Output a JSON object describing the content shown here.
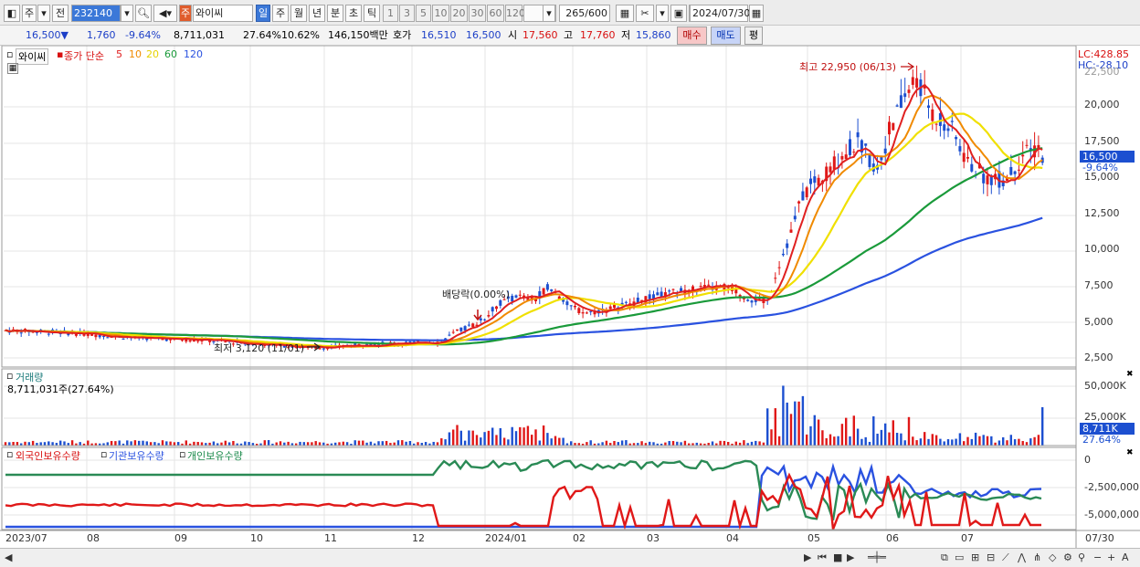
{
  "toolbar": {
    "market_type": "주",
    "prev_label": "전",
    "code": "232140",
    "stock_name": "와이씨",
    "name_prefix": "주",
    "periods": [
      "일",
      "주",
      "월",
      "년",
      "분",
      "초",
      "틱"
    ],
    "period_selected": "일",
    "intervals": [
      "1",
      "3",
      "5",
      "10",
      "20",
      "30",
      "60",
      "120"
    ],
    "count": "265",
    "count_max": "/600",
    "date": "2024/07/30"
  },
  "quote": {
    "price": "16,500",
    "down_mark": "▼",
    "change": "1,760",
    "change_pct": "-9.64%",
    "volume": "8,711,031",
    "turnover_pct": "27.64%",
    "other_pct": "10.62%",
    "amount": "146,150백만",
    "hoga_label": "호가",
    "bid": "16,510",
    "ask": "16,500",
    "open_label": "시",
    "open": "17,560",
    "high_label": "고",
    "high": "17,760",
    "low_label": "저",
    "low": "15,860",
    "buy_label": "매수",
    "sell_label": "매도",
    "avg_label": "평"
  },
  "price_panel": {
    "stock_label": "와이씨",
    "ma_label": "종가 단순",
    "ma_periods": [
      {
        "label": "5",
        "color": "#e02020"
      },
      {
        "label": "10",
        "color": "#f08a00"
      },
      {
        "label": "20",
        "color": "#f0e000"
      },
      {
        "label": "60",
        "color": "#1a9a3a"
      },
      {
        "label": "120",
        "color": "#2a52e0"
      }
    ],
    "lc": "LC:428.85",
    "hc": "HC:-28.10",
    "y_ticks": [
      "22,500",
      "20,000",
      "17,500",
      "15,000",
      "12,500",
      "10,000",
      "7,500",
      "5,000",
      "2,500"
    ],
    "current_tag": "16,500",
    "current_pct": "-9.64%",
    "high_annotation": "최고 22,950 (06/13)",
    "low_annotation": "최저 3,120 (11/01)",
    "dividend_annotation": "배당락(0.00%)"
  },
  "volume_panel": {
    "title": "거래량",
    "value_label": "8,711,031주(27.64%)",
    "y_ticks": [
      "50,000K",
      "25,000K"
    ],
    "current_tag": "8,711K",
    "current_pct": "27.64%"
  },
  "holding_panel": {
    "series_labels": [
      {
        "label": "외국인보유수량",
        "color": "#d81010"
      },
      {
        "label": "기관보유수량",
        "color": "#2a52e0"
      },
      {
        "label": "개인보유수량",
        "color": "#1a8a4a"
      }
    ],
    "y_ticks": [
      "0",
      "-2,500,000",
      "-5,000,000"
    ]
  },
  "x_axis": {
    "labels": [
      "2023/07",
      "08",
      "09",
      "10",
      "11",
      "12",
      "2024/01",
      "02",
      "03",
      "04",
      "05",
      "06",
      "07"
    ],
    "end_label": "07/30"
  },
  "colors": {
    "up": "#e01818",
    "down": "#1c4fd0",
    "ma5": "#e02020",
    "ma10": "#f08a00",
    "ma20": "#f0e000",
    "ma60": "#1a9a3a",
    "ma120": "#2a52e0",
    "grid": "#e4e4e4"
  }
}
